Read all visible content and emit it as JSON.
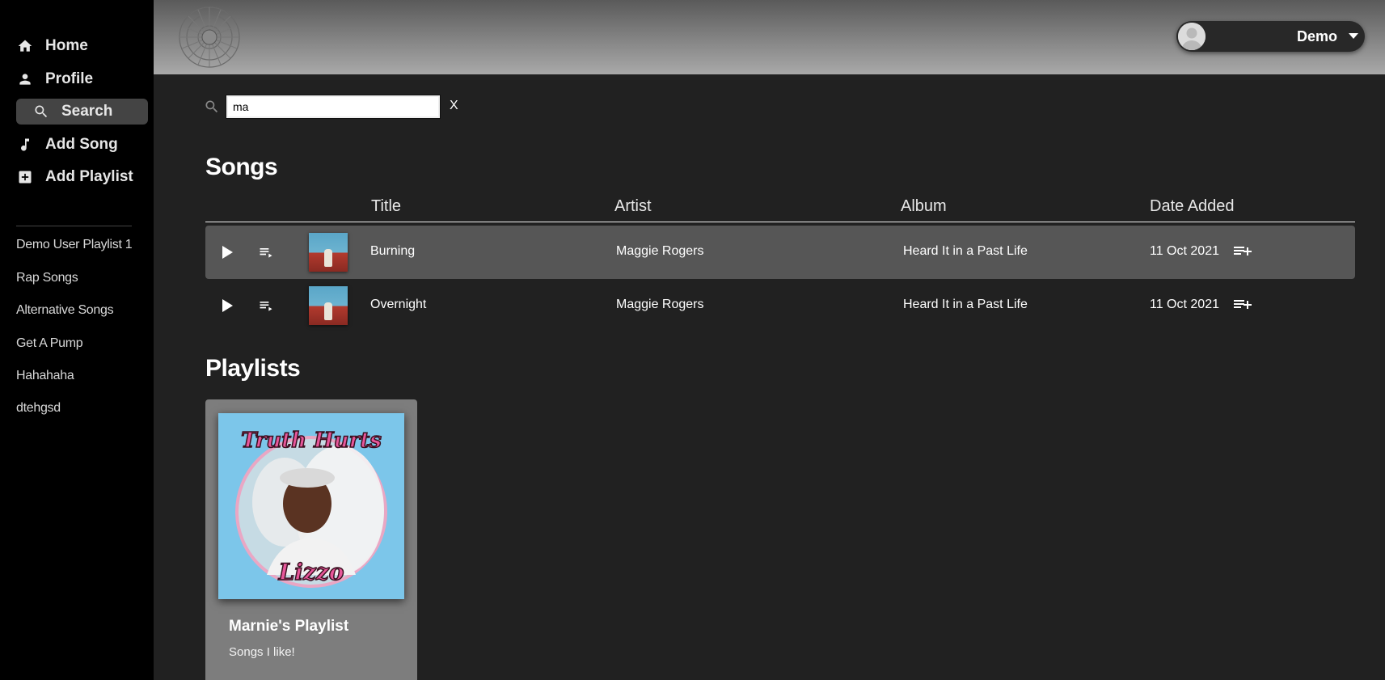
{
  "sidebar": {
    "nav": [
      {
        "label": "Home",
        "icon": "home-icon"
      },
      {
        "label": "Profile",
        "icon": "person-icon"
      },
      {
        "label": "Search",
        "icon": "search-icon",
        "active": true
      },
      {
        "label": "Add Song",
        "icon": "music-note-icon"
      },
      {
        "label": "Add Playlist",
        "icon": "add-box-icon"
      }
    ],
    "playlists": [
      "Demo User Playlist 1",
      "Rap Songs",
      "Alternative Songs",
      "Get A Pump",
      "Hahahaha",
      "dtehgsd"
    ]
  },
  "header": {
    "user": {
      "name": "Demo",
      "avatar_icon": "default-avatar-icon",
      "menu_icon": "caret-down-icon"
    }
  },
  "search": {
    "value": "ma",
    "clear_label": "X"
  },
  "songs": {
    "heading": "Songs",
    "columns": {
      "title": "Title",
      "artist": "Artist",
      "album": "Album",
      "date_added": "Date Added"
    },
    "rows": [
      {
        "title": "Burning",
        "artist": "Maggie Rogers",
        "album": "Heard It in a Past Life",
        "date_added": "11 Oct 2021",
        "highlighted": true
      },
      {
        "title": "Overnight",
        "artist": "Maggie Rogers",
        "album": "Heard It in a Past Life",
        "date_added": "11 Oct 2021",
        "highlighted": false
      }
    ]
  },
  "playlists": {
    "heading": "Playlists",
    "cards": [
      {
        "title": "Marnie's Playlist",
        "description": "Songs I like!",
        "cover_text_top": "Truth Hurts",
        "cover_text_bottom": "Lizzo"
      }
    ]
  },
  "colors": {
    "sidebar_bg": "#000000",
    "main_bg": "#212121",
    "row_highlight": "#565656",
    "card_bg": "#7d7d7d"
  }
}
